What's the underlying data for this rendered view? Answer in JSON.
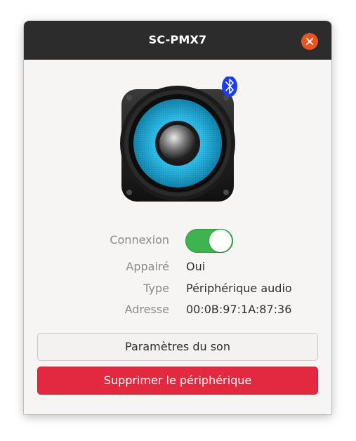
{
  "window": {
    "title": "SC-PMX7"
  },
  "device": {
    "icon": "bluetooth-speaker-icon"
  },
  "info": {
    "connection_label": "Connexion",
    "connection_on": true,
    "paired_label": "Appairé",
    "paired_value": "Oui",
    "type_label": "Type",
    "type_value": "Périphérique audio",
    "address_label": "Adresse",
    "address_value": "00:0B:97:1A:87:36"
  },
  "actions": {
    "sound_settings_label": "Paramètres du son",
    "remove_device_label": "Supprimer le périphérique"
  },
  "colors": {
    "titlebar": "#2c2c2c",
    "close": "#e95420",
    "toggle_on": "#3eb34f",
    "destructive": "#e3293f",
    "bluetooth": "#1a3cf0"
  }
}
